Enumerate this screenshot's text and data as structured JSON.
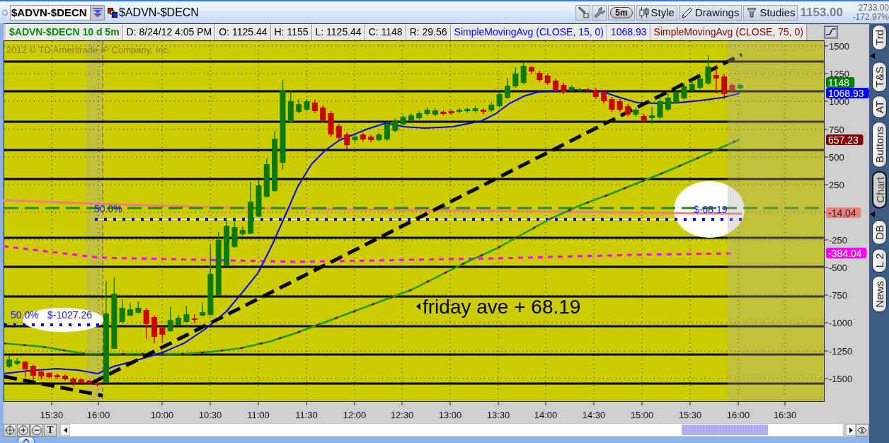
{
  "toolbar": {
    "symbol": "$ADVN-$DECN",
    "linked_symbol": "$ADVN-$DECN",
    "interval": "5m",
    "buttons": [
      "Style",
      "Drawings",
      "Studies"
    ],
    "last_price": "1153.00",
    "quote_value": "2733.00",
    "percent_change": "-172.97%"
  },
  "info_bar": {
    "title": "$ADVN-$DECN 10 d 5m",
    "cells": [
      "D: 8/24/12 4:05 PM",
      "O: 1125.44",
      "H: 1155",
      "L: 1125.44",
      "C: 1148",
      "R: 29.56"
    ],
    "studies": [
      {
        "label": "SimpleMovingAvg (CLOSE, 15, 0)",
        "value": "1068.93",
        "color": "#0000ff"
      },
      {
        "label": "SimpleMovingAvg (CLOSE, 75, 0)",
        "color": "#800000"
      }
    ]
  },
  "chart": {
    "copyright": "2012 © TD Ameritrade IP Company, Inc.",
    "price_axis_labels": [
      "1500",
      "1250",
      "1000",
      "750",
      "500",
      "250",
      "-250",
      "-500",
      "-750",
      "-1000",
      "-1250",
      "-1500"
    ],
    "time_axis_labels": [
      "15:30",
      "16:00",
      "10:00",
      "10:30",
      "11:00",
      "11:30",
      "12:00",
      "12:30",
      "13:00",
      "13:30",
      "14:00",
      "14:30",
      "15:00",
      "15:30",
      "16:00",
      "16:30"
    ],
    "price_badges": [
      {
        "text": "1148",
        "color": "#008000"
      },
      {
        "text": "1068.93",
        "color": "#0000ff"
      },
      {
        "text": "657.23",
        "color": "#800000"
      },
      {
        "text": "-14.04",
        "color": "#f08080"
      },
      {
        "text": "-384.04",
        "color": "#ff00ff"
      }
    ],
    "annotations": [
      {
        "kind": "level_label",
        "text": "50.0%"
      },
      {
        "kind": "bubble",
        "label": "50.0%",
        "value": "$-1027.26"
      },
      {
        "kind": "bubble",
        "value": "$-68.19"
      },
      {
        "kind": "note",
        "text": "friday ave + 68.19"
      }
    ]
  },
  "bottom_toolbar": {
    "text_tool": "T"
  },
  "side_tabs": [
    {
      "label": "Trd",
      "selected": false
    },
    {
      "label": "T&S",
      "selected": false
    },
    {
      "label": "AT",
      "selected": false
    },
    {
      "label": "Buttons",
      "selected": false
    },
    {
      "label": "Chart",
      "selected": true
    },
    {
      "label": "DB",
      "selected": false
    },
    {
      "label": "L 2",
      "selected": false
    },
    {
      "label": "News",
      "selected": false
    }
  ]
}
